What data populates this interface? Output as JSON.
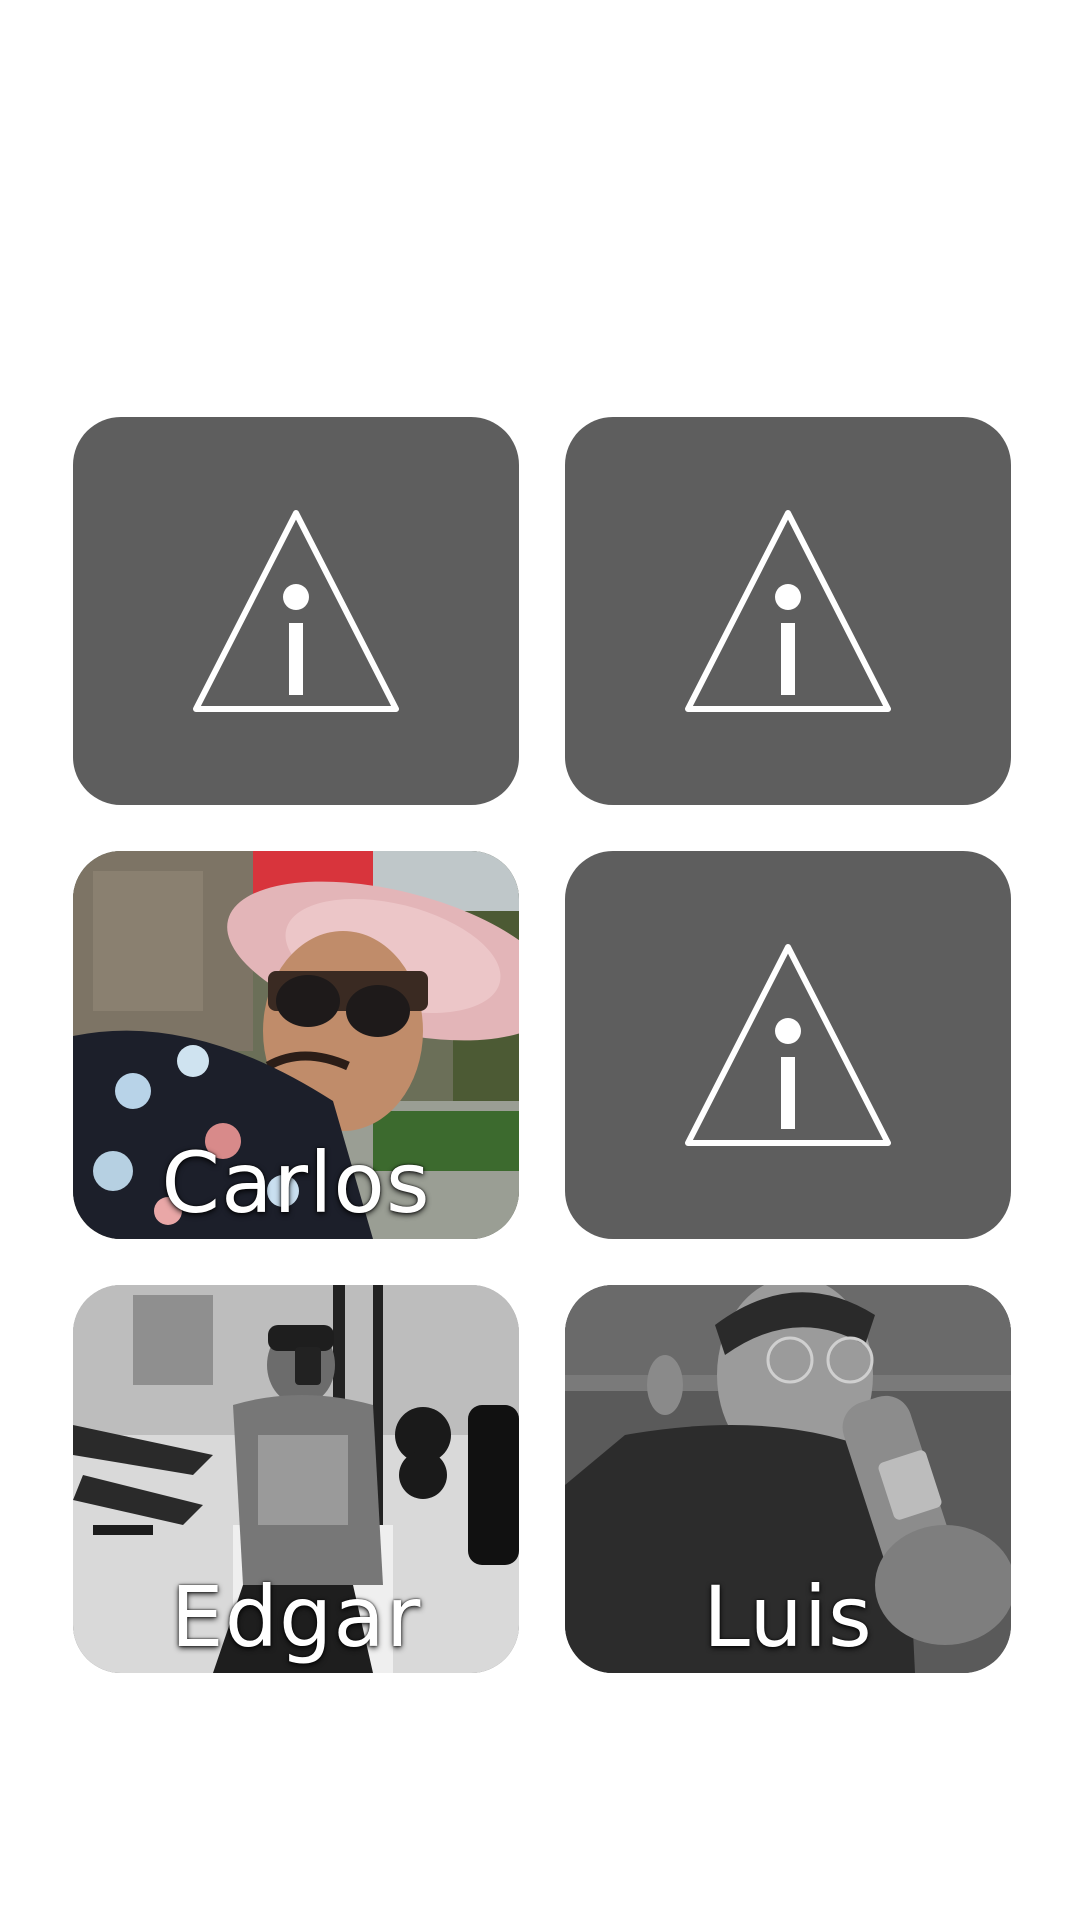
{
  "tiles": [
    {
      "kind": "unavailable",
      "icon": "warning-info-icon"
    },
    {
      "kind": "unavailable",
      "icon": "warning-info-icon"
    },
    {
      "kind": "photo",
      "name": "Carlos",
      "image": "portrait-carlos"
    },
    {
      "kind": "unavailable",
      "icon": "warning-info-icon"
    },
    {
      "kind": "photo",
      "name": "Edgar",
      "image": "portrait-edgar"
    },
    {
      "kind": "photo",
      "name": "Luis",
      "image": "portrait-luis"
    }
  ],
  "colors": {
    "background": "#ffffff",
    "placeholder_tile": "#5e5e5e",
    "icon_stroke": "#ffffff",
    "label_text": "#ffffff"
  }
}
